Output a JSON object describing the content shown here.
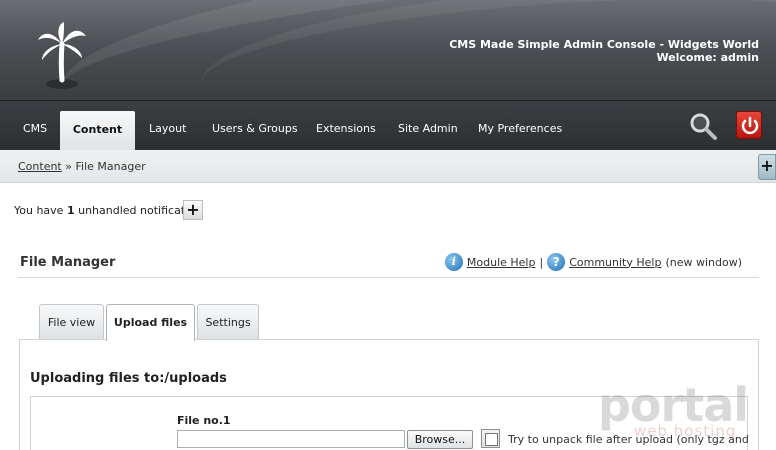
{
  "header": {
    "title": "CMS Made Simple Admin Console - Widgets World",
    "welcome": "Welcome: admin",
    "logo_icon": "palm-tree-icon"
  },
  "nav": {
    "items": [
      {
        "label": "CMS"
      },
      {
        "label": "Content",
        "active": true
      },
      {
        "label": "Layout"
      },
      {
        "label": "Users & Groups"
      },
      {
        "label": "Extensions"
      },
      {
        "label": "Site Admin"
      },
      {
        "label": "My Preferences"
      }
    ],
    "search_icon": "magnifier-icon",
    "logout_icon": "power-icon"
  },
  "breadcrumb": {
    "link": "Content",
    "separator": " » ",
    "current": "File Manager"
  },
  "notification": {
    "prefix": "You have ",
    "count": "1",
    "suffix": " unhandled notification",
    "toggle": "+"
  },
  "expand_toggle": "+",
  "module": {
    "title": "File Manager",
    "module_help": "Module Help",
    "separator": "|",
    "community_help": "Community Help",
    "new_window": "(new window)"
  },
  "tabs": [
    {
      "label": "File view"
    },
    {
      "label": "Upload files",
      "active": true
    },
    {
      "label": "Settings"
    }
  ],
  "upload": {
    "title": "Uploading files to:/uploads",
    "file_label": "File no.1",
    "browse_label": "Browse...",
    "unpack_label": "Try to unpack file after upload (only tgz and"
  },
  "watermark": {
    "main": "portal",
    "sub": "web hosting"
  },
  "colors": {
    "header_bg": "#4d5155",
    "nav_bg": "#2c2f32",
    "logout_red": "#d12e23",
    "help_blue": "#1e6fb3"
  }
}
